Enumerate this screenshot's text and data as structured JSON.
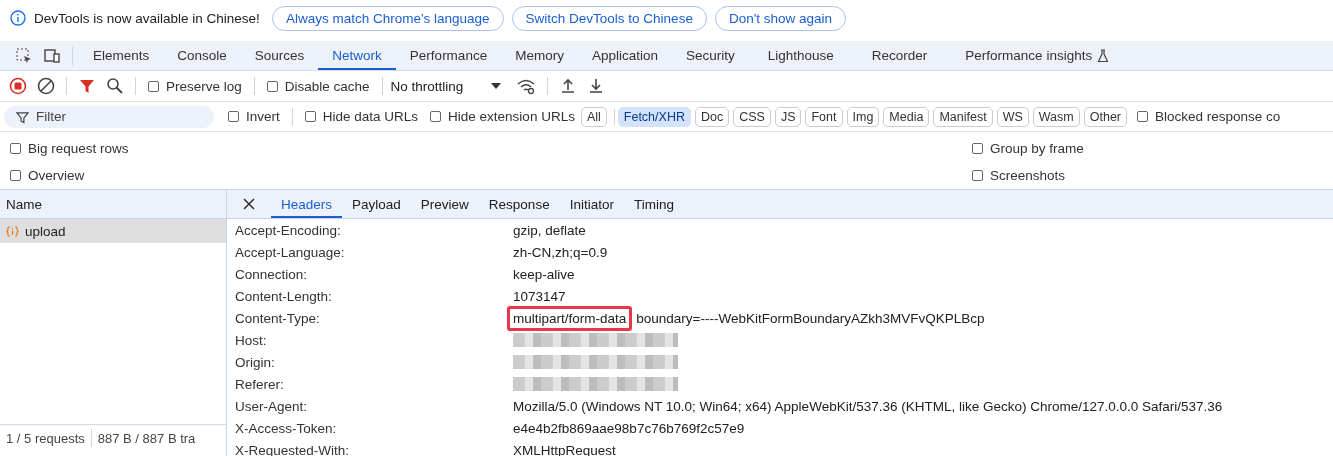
{
  "infobar": {
    "message": "DevTools is now available in Chinese!",
    "buttons": [
      "Always match Chrome's language",
      "Switch DevTools to Chinese",
      "Don't show again"
    ]
  },
  "main_tabs": [
    {
      "label": "Elements",
      "selected": false
    },
    {
      "label": "Console",
      "selected": false
    },
    {
      "label": "Sources",
      "selected": false
    },
    {
      "label": "Network",
      "selected": true
    },
    {
      "label": "Performance",
      "selected": false
    },
    {
      "label": "Memory",
      "selected": false
    },
    {
      "label": "Application",
      "selected": false
    },
    {
      "label": "Security",
      "selected": false
    },
    {
      "label": "Lighthouse",
      "selected": false
    },
    {
      "label": "Recorder",
      "selected": false
    },
    {
      "label": "Performance insights",
      "selected": false,
      "experimental": true
    }
  ],
  "toolbar": {
    "recording": true,
    "filter_active": true,
    "options": [
      {
        "label": "Preserve log",
        "checked": false
      },
      {
        "label": "Disable cache",
        "checked": false
      }
    ],
    "throttling": "No throttling"
  },
  "filter_bar": {
    "placeholder": "Filter",
    "options": [
      {
        "label": "Invert",
        "checked": false
      },
      {
        "label": "Hide data URLs",
        "checked": false
      },
      {
        "label": "Hide extension URLs",
        "checked": false
      }
    ],
    "types": [
      {
        "label": "All",
        "selected": false
      },
      {
        "label": "Fetch/XHR",
        "selected": true
      },
      {
        "label": "Doc",
        "selected": false
      },
      {
        "label": "CSS",
        "selected": false
      },
      {
        "label": "JS",
        "selected": false
      },
      {
        "label": "Font",
        "selected": false
      },
      {
        "label": "Img",
        "selected": false
      },
      {
        "label": "Media",
        "selected": false
      },
      {
        "label": "Manifest",
        "selected": false
      },
      {
        "label": "WS",
        "selected": false
      },
      {
        "label": "Wasm",
        "selected": false
      },
      {
        "label": "Other",
        "selected": false
      }
    ],
    "blocked": {
      "label": "Blocked response co",
      "checked": false
    }
  },
  "settings_left": [
    {
      "label": "Big request rows",
      "checked": false
    },
    {
      "label": "Overview",
      "checked": false
    }
  ],
  "settings_right": [
    {
      "label": "Group by frame",
      "checked": false
    },
    {
      "label": "Screenshots",
      "checked": false
    }
  ],
  "requests": {
    "column": "Name",
    "rows": [
      {
        "name": "upload",
        "selected": true
      }
    ],
    "status": [
      "1 / 5 requests",
      "887 B / 887 B tra"
    ]
  },
  "detail_tabs": [
    {
      "label": "Headers",
      "selected": true
    },
    {
      "label": "Payload",
      "selected": false
    },
    {
      "label": "Preview",
      "selected": false
    },
    {
      "label": "Response",
      "selected": false
    },
    {
      "label": "Initiator",
      "selected": false
    },
    {
      "label": "Timing",
      "selected": false
    }
  ],
  "headers": [
    {
      "name": "Accept-Encoding:",
      "value": "gzip, deflate"
    },
    {
      "name": "Accept-Language:",
      "value": "zh-CN,zh;q=0.9"
    },
    {
      "name": "Connection:",
      "value": "keep-alive"
    },
    {
      "name": "Content-Length:",
      "value": "1073147"
    },
    {
      "name": "Content-Type:",
      "value": "multipart/form-data",
      "value_rest": "boundary=----WebKitFormBoundaryAZkh3MVFvQKPLBcp",
      "highlighted": true
    },
    {
      "name": "Host:",
      "redacted": true
    },
    {
      "name": "Origin:",
      "redacted": true
    },
    {
      "name": "Referer:",
      "redacted": true
    },
    {
      "name": "User-Agent:",
      "value": "Mozilla/5.0 (Windows NT 10.0; Win64; x64) AppleWebKit/537.36 (KHTML, like Gecko) Chrome/127.0.0.0 Safari/537.36"
    },
    {
      "name": "X-Access-Token:",
      "value": "e4e4b2fb869aae98b7c76b769f2c57e9"
    },
    {
      "name": "X-Requested-With:",
      "value": "XMLHttpRequest"
    }
  ]
}
